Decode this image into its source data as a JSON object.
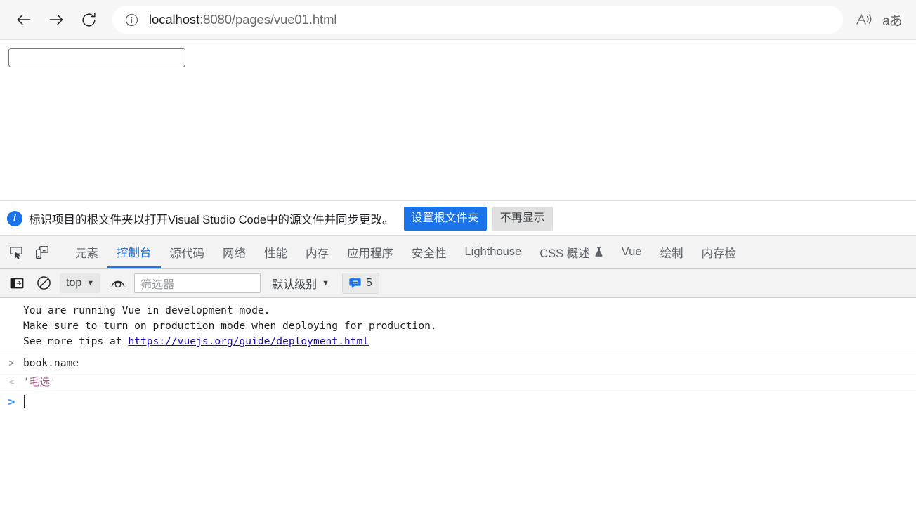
{
  "browser": {
    "back_label": "Back",
    "forward_label": "Forward",
    "reload_label": "Refresh",
    "site_info_label": "View site information",
    "url_host": "localhost",
    "url_path": ":8080/pages/vue01.html",
    "read_aloud_label": "Read aloud",
    "translate_label": "aあ"
  },
  "page": {
    "input_value": "",
    "input_placeholder": ""
  },
  "notice": {
    "icon": "info-icon",
    "message": "标识项目的根文件夹以打开Visual Studio Code中的源文件并同步更改。",
    "primary_button": "设置根文件夹",
    "secondary_button": "不再显示"
  },
  "devtools": {
    "inspect_icon": "inspect-element-icon",
    "device_icon": "device-toolbar-icon",
    "tabs": [
      {
        "label": "元素",
        "active": false
      },
      {
        "label": "控制台",
        "active": true
      },
      {
        "label": "源代码",
        "active": false
      },
      {
        "label": "网络",
        "active": false
      },
      {
        "label": "性能",
        "active": false
      },
      {
        "label": "内存",
        "active": false
      },
      {
        "label": "应用程序",
        "active": false
      },
      {
        "label": "安全性",
        "active": false
      },
      {
        "label": "Lighthouse",
        "active": false
      },
      {
        "label": "CSS 概述",
        "active": false,
        "experimental": true
      },
      {
        "label": "Vue",
        "active": false
      },
      {
        "label": "绘制",
        "active": false
      },
      {
        "label": "内存检",
        "active": false
      }
    ],
    "console_toolbar": {
      "sidebar_icon": "console-sidebar-icon",
      "clear_icon": "clear-console-icon",
      "context": "top",
      "live_expression_icon": "eye-icon",
      "filter_placeholder": "筛选器",
      "filter_value": "",
      "level_label": "默认级别",
      "message_count": "5",
      "message_icon": "speech-bubble-icon"
    },
    "console": {
      "warning_lines": [
        "You are running Vue in development mode.",
        "Make sure to turn on production mode when deploying for production.",
        "See more tips at "
      ],
      "warning_link": "https://vuejs.org/guide/deployment.html",
      "input_expression": "book.name",
      "output_value": "'毛选'",
      "prompt_symbol": ">",
      "input_gutter": ">",
      "output_gutter": "<",
      "current_input": ""
    }
  },
  "colors": {
    "accent_blue": "#1a73e8",
    "string_mauve": "#a45a8a",
    "link_blue": "#1a0dab",
    "toolbar_bg": "#f3f3f3"
  }
}
